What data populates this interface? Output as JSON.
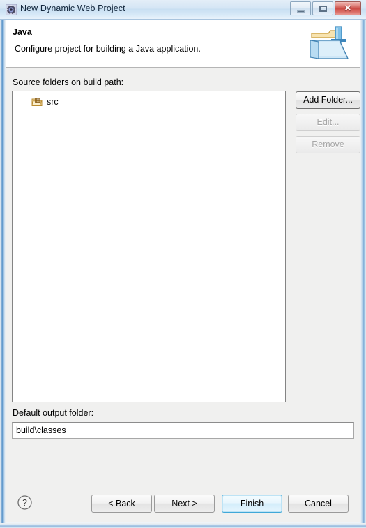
{
  "window": {
    "title": "New Dynamic Web Project",
    "title_icon": "eclipse-wizard-icon",
    "minimize_label": "–",
    "maximize_label": "□",
    "close_label": "✕"
  },
  "header": {
    "title": "Java",
    "description": "Configure project for building a Java application.",
    "banner_icon": "java-build-path-folder-icon"
  },
  "main": {
    "source_label": "Source folders on build path:",
    "source_folders": [
      {
        "name": "src",
        "icon": "source-folder-icon"
      }
    ],
    "side_buttons": [
      {
        "label": "Add Folder...",
        "enabled": true
      },
      {
        "label": "Edit...",
        "enabled": false
      },
      {
        "label": "Remove",
        "enabled": false
      }
    ],
    "output_label": "Default output folder:",
    "output_value": "build\\classes",
    "output_placeholder": ""
  },
  "footer": {
    "help_icon": "help-question-icon",
    "back_label": "< Back",
    "next_label": "Next >",
    "finish_label": "Finish",
    "cancel_label": "Cancel"
  },
  "colors": {
    "titlebar_start": "#e4eef8",
    "titlebar_end": "#e9f2fb",
    "close_button": "#cb4c46",
    "dialog_background": "#f0f0ef",
    "header_background": "#ffffff",
    "default_button_border": "#3fa8d8",
    "disabled_text": "#a6a6a6",
    "glass_border": "#5d96ca"
  }
}
